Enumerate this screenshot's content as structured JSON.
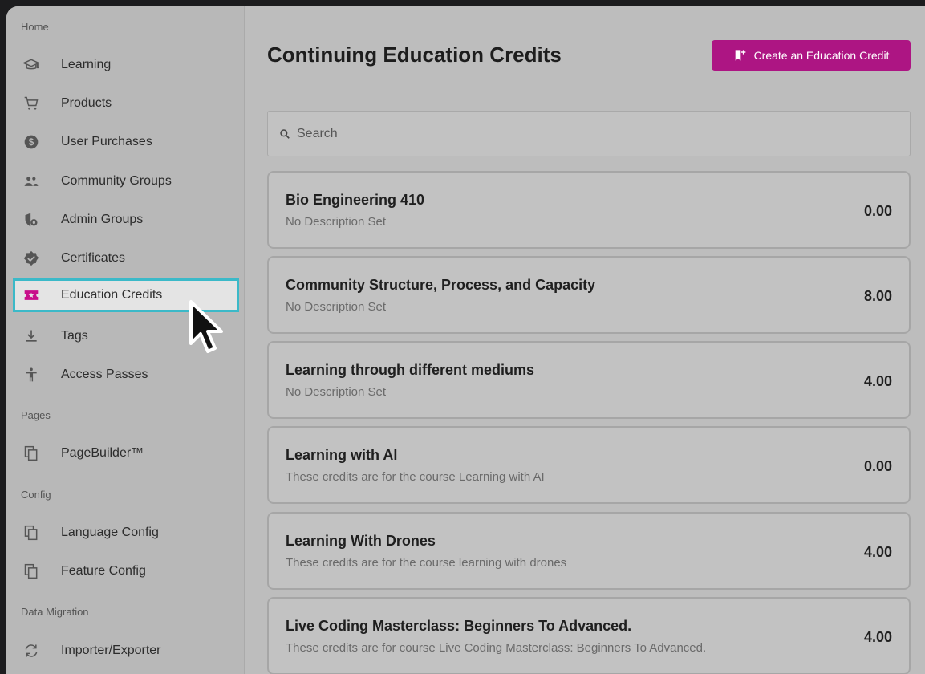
{
  "sidebar": {
    "sections": [
      {
        "label": "Home",
        "items": [
          {
            "label": "Learning",
            "icon": "graduation-cap-icon"
          },
          {
            "label": "Products",
            "icon": "cart-icon"
          },
          {
            "label": "User Purchases",
            "icon": "dollar-circle-icon"
          },
          {
            "label": "Community Groups",
            "icon": "people-icon"
          },
          {
            "label": "Admin Groups",
            "icon": "shield-gear-icon"
          },
          {
            "label": "Certificates",
            "icon": "badge-check-icon"
          },
          {
            "label": "Education Credits",
            "icon": "ticket-star-icon",
            "active": true
          },
          {
            "label": "Tags",
            "icon": "download-icon"
          },
          {
            "label": "Access Passes",
            "icon": "accessibility-icon"
          }
        ]
      },
      {
        "label": "Pages",
        "items": [
          {
            "label": "PageBuilder™",
            "icon": "copy-pages-icon"
          }
        ]
      },
      {
        "label": "Config",
        "items": [
          {
            "label": "Language Config",
            "icon": "copy-pages-icon"
          },
          {
            "label": "Feature Config",
            "icon": "copy-pages-icon"
          }
        ]
      },
      {
        "label": "Data Migration",
        "items": [
          {
            "label": "Importer/Exporter",
            "icon": "sync-arrows-icon"
          }
        ]
      }
    ]
  },
  "header": {
    "title": "Continuing Education Credits",
    "create_button_label": "Create an Education Credit"
  },
  "search": {
    "placeholder": "Search"
  },
  "credits": [
    {
      "title": "Bio Engineering 410",
      "description": "No Description Set",
      "value": "0.00"
    },
    {
      "title": "Community Structure, Process, and Capacity",
      "description": "No Description Set",
      "value": "8.00"
    },
    {
      "title": "Learning through different mediums",
      "description": "No Description Set",
      "value": "4.00"
    },
    {
      "title": "Learning with AI",
      "description": "These credits are for the course Learning with AI",
      "value": "0.00"
    },
    {
      "title": "Learning With Drones",
      "description": "These credits are for the course learning with drones",
      "value": "4.00"
    },
    {
      "title": "Live Coding Masterclass: Beginners To Advanced.",
      "description": "These credits are for course Live Coding Masterclass: Beginners To Advanced.",
      "value": "4.00"
    }
  ],
  "colors": {
    "accent": "#ad1583",
    "highlight_border": "#3bb9c8"
  }
}
